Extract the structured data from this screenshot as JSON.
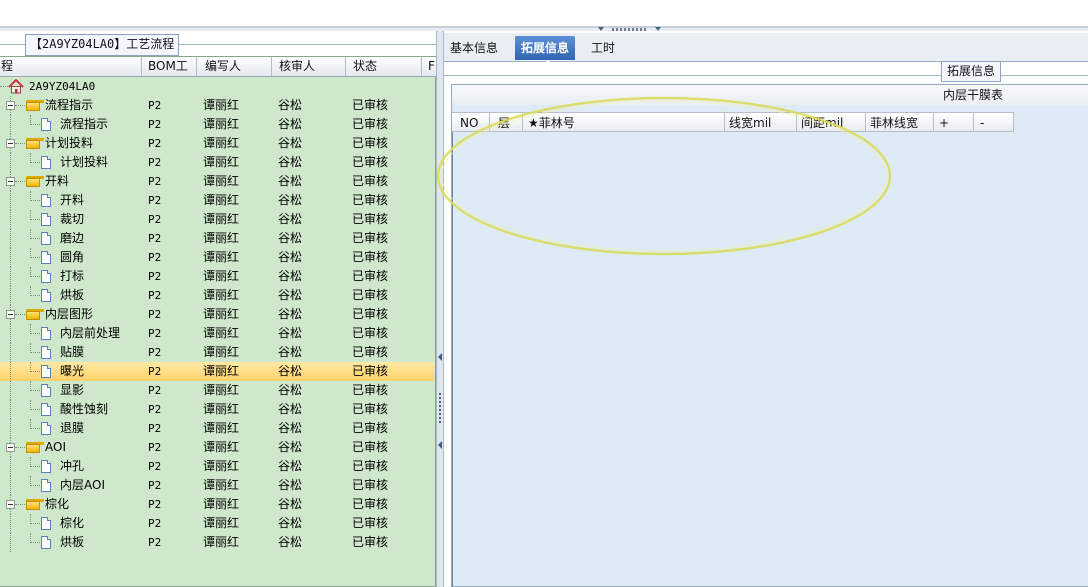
{
  "left": {
    "caption": "【2A9YZ04LA0】工艺流程",
    "columns": [
      "程",
      "BOM工厂",
      "编写人",
      "核审人",
      "状态",
      "F"
    ],
    "root": "2A9YZ04LA0",
    "rows": [
      {
        "label": "流程指示",
        "type": "folder",
        "depth": 1,
        "bom": "P2",
        "writer": "谭丽红",
        "reviewer": "谷松",
        "status": "已审核"
      },
      {
        "label": "流程指示",
        "type": "doc",
        "depth": 2,
        "bom": "P2",
        "writer": "谭丽红",
        "reviewer": "谷松",
        "status": "已审核"
      },
      {
        "label": "计划投料",
        "type": "folder",
        "depth": 1,
        "bom": "P2",
        "writer": "谭丽红",
        "reviewer": "谷松",
        "status": "已审核"
      },
      {
        "label": "计划投料",
        "type": "doc",
        "depth": 2,
        "bom": "P2",
        "writer": "谭丽红",
        "reviewer": "谷松",
        "status": "已审核"
      },
      {
        "label": "开料",
        "type": "folder",
        "depth": 1,
        "bom": "P2",
        "writer": "谭丽红",
        "reviewer": "谷松",
        "status": "已审核"
      },
      {
        "label": "开料",
        "type": "doc",
        "depth": 2,
        "bom": "P2",
        "writer": "谭丽红",
        "reviewer": "谷松",
        "status": "已审核"
      },
      {
        "label": "裁切",
        "type": "doc",
        "depth": 2,
        "bom": "P2",
        "writer": "谭丽红",
        "reviewer": "谷松",
        "status": "已审核"
      },
      {
        "label": "磨边",
        "type": "doc",
        "depth": 2,
        "bom": "P2",
        "writer": "谭丽红",
        "reviewer": "谷松",
        "status": "已审核"
      },
      {
        "label": "圆角",
        "type": "doc",
        "depth": 2,
        "bom": "P2",
        "writer": "谭丽红",
        "reviewer": "谷松",
        "status": "已审核"
      },
      {
        "label": "打标",
        "type": "doc",
        "depth": 2,
        "bom": "P2",
        "writer": "谭丽红",
        "reviewer": "谷松",
        "status": "已审核"
      },
      {
        "label": "烘板",
        "type": "doc",
        "depth": 2,
        "bom": "P2",
        "writer": "谭丽红",
        "reviewer": "谷松",
        "status": "已审核"
      },
      {
        "label": "内层图形",
        "type": "folder",
        "depth": 1,
        "bom": "P2",
        "writer": "谭丽红",
        "reviewer": "谷松",
        "status": "已审核"
      },
      {
        "label": "内层前处理",
        "type": "doc",
        "depth": 2,
        "bom": "P2",
        "writer": "谭丽红",
        "reviewer": "谷松",
        "status": "已审核"
      },
      {
        "label": "贴膜",
        "type": "doc",
        "depth": 2,
        "bom": "P2",
        "writer": "谭丽红",
        "reviewer": "谷松",
        "status": "已审核"
      },
      {
        "label": "曝光",
        "type": "doc",
        "depth": 2,
        "bom": "P2",
        "writer": "谭丽红",
        "reviewer": "谷松",
        "status": "已审核",
        "selected": true
      },
      {
        "label": "显影",
        "type": "doc",
        "depth": 2,
        "bom": "P2",
        "writer": "谭丽红",
        "reviewer": "谷松",
        "status": "已审核"
      },
      {
        "label": "酸性蚀刻",
        "type": "doc",
        "depth": 2,
        "bom": "P2",
        "writer": "谭丽红",
        "reviewer": "谷松",
        "status": "已审核"
      },
      {
        "label": "退膜",
        "type": "doc",
        "depth": 2,
        "bom": "P2",
        "writer": "谭丽红",
        "reviewer": "谷松",
        "status": "已审核"
      },
      {
        "label": "AOI",
        "type": "folder",
        "depth": 1,
        "bom": "P2",
        "writer": "谭丽红",
        "reviewer": "谷松",
        "status": "已审核"
      },
      {
        "label": "冲孔",
        "type": "doc",
        "depth": 2,
        "bom": "P2",
        "writer": "谭丽红",
        "reviewer": "谷松",
        "status": "已审核"
      },
      {
        "label": "内层AOI",
        "type": "doc",
        "depth": 2,
        "bom": "P2",
        "writer": "谭丽红",
        "reviewer": "谷松",
        "status": "已审核"
      },
      {
        "label": "棕化",
        "type": "folder",
        "depth": 1,
        "bom": "P2",
        "writer": "谭丽红",
        "reviewer": "谷松",
        "status": "已审核"
      },
      {
        "label": "棕化",
        "type": "doc",
        "depth": 2,
        "bom": "P2",
        "writer": "谭丽红",
        "reviewer": "谷松",
        "status": "已审核"
      },
      {
        "label": "烘板",
        "type": "doc",
        "depth": 2,
        "bom": "P2",
        "writer": "谭丽红",
        "reviewer": "谷松",
        "status": "已审核"
      }
    ]
  },
  "right": {
    "tabs": [
      {
        "label": "基本信息",
        "active": false
      },
      {
        "label": "拓展信息",
        "active": true
      },
      {
        "label": "工时",
        "active": false
      }
    ],
    "sub_caption": "拓展信息",
    "grid_title": "内层干膜表",
    "grid_columns": [
      "NO",
      "层",
      "★菲林号",
      "线宽mil",
      "间距mil",
      "菲林线宽",
      "+",
      "-"
    ]
  },
  "colors": {
    "tree_bg": "#cfe8cc",
    "selected_row": "#ffd26a",
    "active_tab": "#2f65b3",
    "grid_bg": "#dfeaf7",
    "annotation": "#e8e85a"
  },
  "icons": {
    "root": "house-icon",
    "folder": "folder-icon",
    "doc": "document-icon",
    "expand": "minus-box-icon"
  }
}
